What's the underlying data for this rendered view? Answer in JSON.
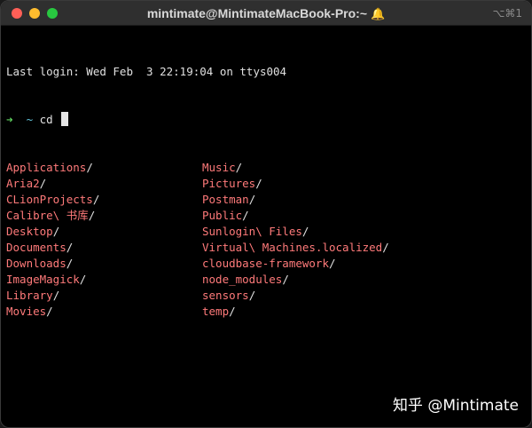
{
  "window": {
    "title": "mintimate@MintimateMacBook-Pro:~",
    "bell_glyph": "🔔",
    "shortcut": "⌥⌘1"
  },
  "terminal": {
    "last_login": "Last login: Wed Feb  3 22:19:04 on ttys004",
    "prompt_arrow": "➜",
    "prompt_dir": "~",
    "command": "cd",
    "listing_left": [
      "Applications",
      "Aria2",
      "CLionProjects",
      "Calibre\\ 书库",
      "Desktop",
      "Documents",
      "Downloads",
      "ImageMagick",
      "Library",
      "Movies"
    ],
    "listing_right": [
      "Music",
      "Pictures",
      "Postman",
      "Public",
      "Sunlogin\\ Files",
      "Virtual\\ Machines.localized",
      "cloudbase-framework",
      "node_modules",
      "sensors",
      "temp"
    ],
    "slash": "/"
  },
  "colors": {
    "directory": "#ff7a7a",
    "prompt_arrow": "#5fd35f",
    "prompt_dir": "#61c3d9",
    "background": "#000000"
  },
  "watermark": "知乎 @Mintimate"
}
